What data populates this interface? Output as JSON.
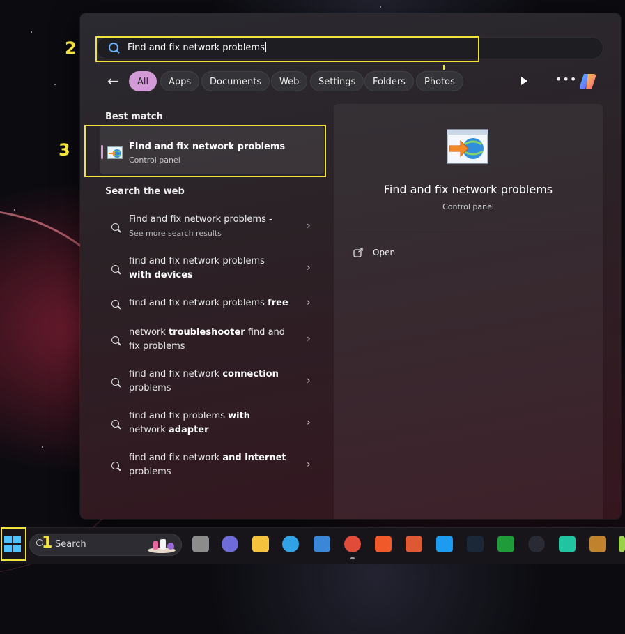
{
  "annotations": [
    "1",
    "2",
    "3"
  ],
  "search": {
    "query": "Find and fix network problems"
  },
  "filters": [
    "All",
    "Apps",
    "Documents",
    "Web",
    "Settings",
    "Folders",
    "Photos"
  ],
  "best_match": {
    "heading": "Best match",
    "title": "Find and fix network problems",
    "subtitle": "Control panel"
  },
  "web": {
    "heading": "Search the web",
    "items": [
      {
        "parts": [
          [
            "Find and fix network problems -",
            false
          ]
        ],
        "sub": "See more search results"
      },
      {
        "parts": [
          [
            "find and fix network problems ",
            false
          ],
          [
            "with devices",
            true
          ]
        ]
      },
      {
        "parts": [
          [
            "find and fix network problems ",
            false
          ],
          [
            "free",
            true
          ]
        ]
      },
      {
        "parts": [
          [
            "network ",
            false
          ],
          [
            "troubleshooter",
            true
          ],
          [
            " find and fix problems",
            false
          ]
        ]
      },
      {
        "parts": [
          [
            "find and fix network ",
            false
          ],
          [
            "connection",
            true
          ],
          [
            " problems",
            false
          ]
        ]
      },
      {
        "parts": [
          [
            "find and fix problems ",
            false
          ],
          [
            "with",
            true
          ],
          [
            " network ",
            false
          ],
          [
            "adapter",
            true
          ]
        ]
      },
      {
        "parts": [
          [
            "find and fix network ",
            false
          ],
          [
            "and internet",
            true
          ],
          [
            " problems",
            false
          ]
        ]
      }
    ]
  },
  "preview": {
    "title": "Find and fix network problems",
    "subtitle": "Control panel",
    "action": "Open"
  },
  "taskbar": {
    "search_label": "Search",
    "icons": [
      "task-view-icon",
      "chat-icon",
      "file-explorer-icon",
      "edge-icon",
      "store-icon",
      "chrome-icon",
      "brave-icon",
      "duckduckgo-icon",
      "twitter-icon",
      "steam-icon",
      "xbox-icon",
      "speedtest-icon",
      "app-icon",
      "package-icon",
      "partial-icon"
    ]
  },
  "colors": {
    "accent": "#d39ad8",
    "highlight": "#f2e33a"
  }
}
